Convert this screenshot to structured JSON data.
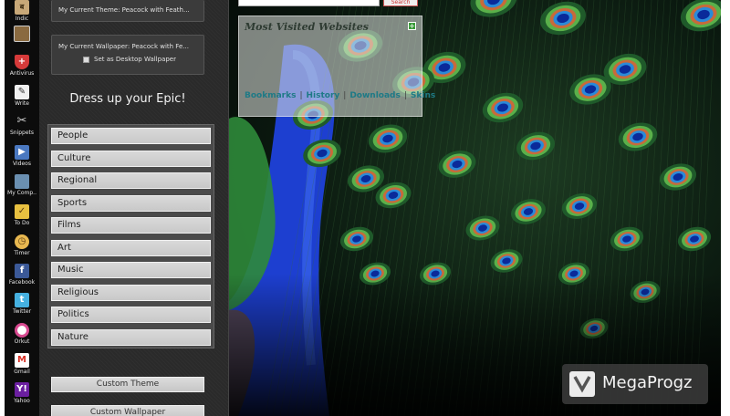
{
  "sidebar": {
    "items": [
      {
        "label": "Indic",
        "icon": "indic-icon",
        "color": "#c8a878"
      },
      {
        "label": "",
        "icon": "theme-icon",
        "color": "#8a6a40"
      },
      {
        "label": "Antivirus",
        "icon": "antivirus-shield-icon",
        "color": "#d63a3a"
      },
      {
        "label": "Write",
        "icon": "write-icon",
        "color": "#f0f0f0"
      },
      {
        "label": "Snippets",
        "icon": "scissors-icon",
        "color": "#d0d0d0"
      },
      {
        "label": "Videos",
        "icon": "video-icon",
        "color": "#4a78c0"
      },
      {
        "label": "My Comp..",
        "icon": "computer-icon",
        "color": "#6a8fb0"
      },
      {
        "label": "To Do",
        "icon": "todo-icon",
        "color": "#e8c040"
      },
      {
        "label": "Timer",
        "icon": "timer-icon",
        "color": "#e8b850"
      },
      {
        "label": "Facebook",
        "icon": "facebook-icon",
        "color": "#3b5998"
      },
      {
        "label": "Twitter",
        "icon": "twitter-icon",
        "color": "#45b0e0"
      },
      {
        "label": "Orkut",
        "icon": "orkut-icon",
        "color": "#d84a90"
      },
      {
        "label": "Gmail",
        "icon": "gmail-icon",
        "color": "#d93025"
      },
      {
        "label": "Yahoo",
        "icon": "yahoo-icon",
        "color": "#6b1fa0"
      }
    ]
  },
  "panel": {
    "current_theme": "My Current Theme: Peacock with Feath...",
    "current_wallpaper": "My Current Wallpaper: Peacock with Fe...",
    "set_desktop": "Set as Desktop Wallpaper",
    "dress_up_title": "Dress up your Epic!",
    "categories": [
      "People",
      "Culture",
      "Regional",
      "Sports",
      "Films",
      "Art",
      "Music",
      "Religious",
      "Politics",
      "Nature"
    ],
    "custom_theme": "Custom Theme",
    "custom_wallpaper": "Custom Wallpaper"
  },
  "search": {
    "button_label": "Search"
  },
  "most_visited": {
    "title": "Most Visited Websites",
    "add_label": "+",
    "links": [
      "Bookmarks",
      "History",
      "Downloads",
      "Skins"
    ]
  },
  "watermark": {
    "text": "MegaProgz"
  },
  "colors": {
    "panel_bg": "#2a2a2a",
    "link": "#1e7a86",
    "peacock_blue": "#1d3fd0",
    "feather_green": "#2f8a3a"
  }
}
